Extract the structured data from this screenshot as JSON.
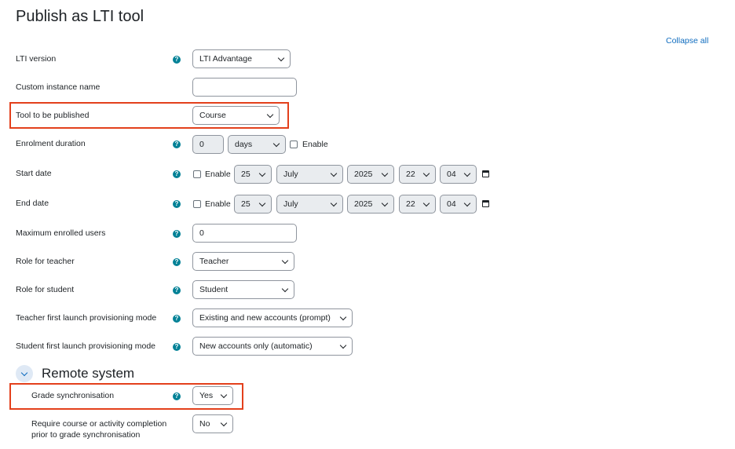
{
  "page": {
    "title": "Publish as LTI tool",
    "collapse_all": "Collapse all"
  },
  "fields": {
    "lti_version": {
      "label": "LTI version",
      "value": "LTI Advantage"
    },
    "custom_instance_name": {
      "label": "Custom instance name",
      "value": ""
    },
    "tool_to_publish": {
      "label": "Tool to be published",
      "value": "Course"
    },
    "enrolment_duration": {
      "label": "Enrolment duration",
      "number": "0",
      "unit": "days",
      "enable_label": "Enable"
    },
    "start_date": {
      "label": "Start date",
      "enable_label": "Enable",
      "day": "25",
      "month": "July",
      "year": "2025",
      "hour": "22",
      "minute": "04"
    },
    "end_date": {
      "label": "End date",
      "enable_label": "Enable",
      "day": "25",
      "month": "July",
      "year": "2025",
      "hour": "22",
      "minute": "04"
    },
    "max_enrolled": {
      "label": "Maximum enrolled users",
      "value": "0"
    },
    "role_teacher": {
      "label": "Role for teacher",
      "value": "Teacher"
    },
    "role_student": {
      "label": "Role for student",
      "value": "Student"
    },
    "teacher_provisioning": {
      "label": "Teacher first launch provisioning mode",
      "value": "Existing and new accounts (prompt)"
    },
    "student_provisioning": {
      "label": "Student first launch provisioning mode",
      "value": "New accounts only (automatic)"
    }
  },
  "remote_system": {
    "title": "Remote system",
    "grade_sync": {
      "label": "Grade synchronisation",
      "value": "Yes"
    },
    "require_completion": {
      "label_line1": "Require course or activity completion",
      "label_line2": "prior to grade synchronisation",
      "value": "No"
    }
  },
  "colors": {
    "highlight": "#e3401c",
    "help_icon": "#008196",
    "link": "#0f6cbf"
  }
}
